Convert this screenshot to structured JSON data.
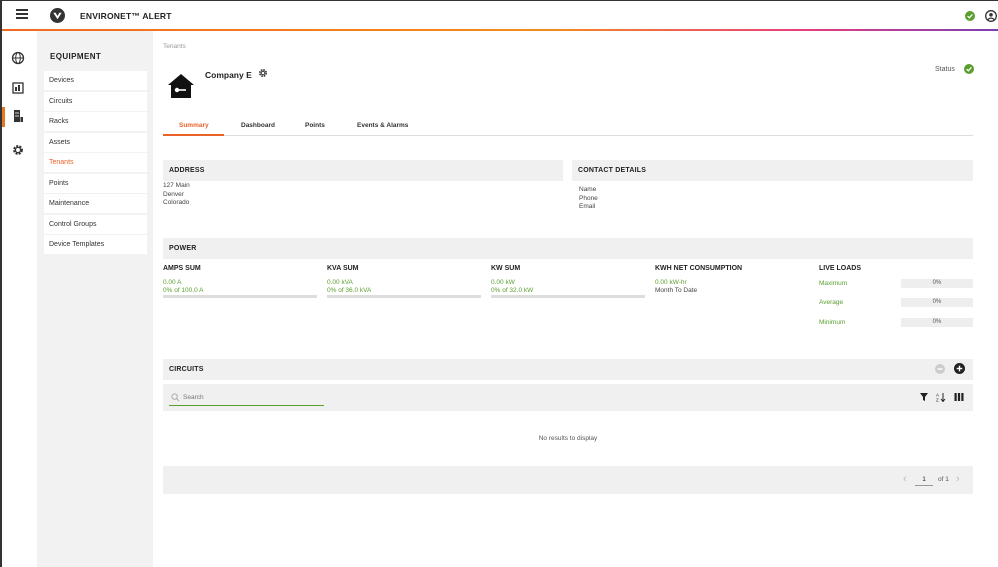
{
  "app": {
    "title": "ENVIRONET™ ALERT"
  },
  "icons": {
    "menu": "hamburger-menu-icon",
    "logo": "environet-logo-icon",
    "status": "check-circle-icon",
    "user": "user-icon",
    "globe": "globe-icon",
    "dashboard": "dashboard-icon",
    "equipment": "equipment-icon",
    "settings": "gear-icon"
  },
  "colors": {
    "accent": "#e8622a",
    "green": "#5a9e2f",
    "panel": "#f0f0f0"
  },
  "sidebar": {
    "heading": "EQUIPMENT",
    "items": [
      {
        "label": "Devices"
      },
      {
        "label": "Circuits"
      },
      {
        "label": "Racks"
      },
      {
        "label": "Assets"
      },
      {
        "label": "Tenants",
        "active": true
      },
      {
        "label": "Points"
      },
      {
        "label": "Maintenance"
      },
      {
        "label": "Control Groups"
      },
      {
        "label": "Device Templates"
      }
    ]
  },
  "breadcrumb": "Tenants",
  "tenant": {
    "name": "Company E",
    "status_label": "Status"
  },
  "tabs": [
    {
      "label": "Summary"
    },
    {
      "label": "Dashboard"
    },
    {
      "label": "Points"
    },
    {
      "label": "Events & Alarms"
    }
  ],
  "address": {
    "heading": "ADDRESS",
    "lines": [
      "127 Main",
      "Denver",
      "Colorado"
    ]
  },
  "contact": {
    "heading": "CONTACT DETAILS",
    "lines": [
      "Name",
      "Phone",
      "Email"
    ]
  },
  "power": {
    "heading": "POWER",
    "amps": {
      "title": "AMPS SUM",
      "value": "0.00 A",
      "of": "0% of 100.0 A"
    },
    "kva": {
      "title": "KVA SUM",
      "value": "0.00 kVA",
      "of": "0% of 36.0 kVA"
    },
    "kw": {
      "title": "KW SUM",
      "value": "0.00 kW",
      "of": "0% of 32.0 kW"
    },
    "kwh": {
      "title": "KWH NET CONSUMPTION",
      "value": "0.00 kW-hr",
      "sub": "Month To Date"
    },
    "live": {
      "title": "LIVE LOADS",
      "rows": [
        {
          "label": "Maximum",
          "value": "0%"
        },
        {
          "label": "Average",
          "value": "0%"
        },
        {
          "label": "Minimum",
          "value": "0%"
        }
      ]
    }
  },
  "circuits": {
    "heading": "CIRCUITS",
    "search_placeholder": "Search",
    "empty_text": "No results to display",
    "pager": {
      "page": "1",
      "of_text": "of 1"
    }
  }
}
